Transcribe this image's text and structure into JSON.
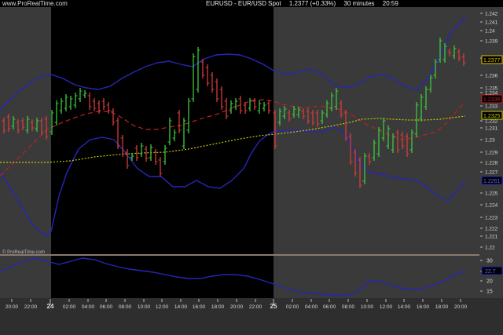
{
  "header": {
    "site": "www.ProRealTime.com",
    "symbol": "EURUSD - EUR/USD Spot",
    "price": "1.2377 (+0.33%)",
    "timeframe": "30 minutes",
    "clock": "20:59"
  },
  "watermark": "© ProRealTime.com",
  "price_axis": {
    "ticks": [
      "1.242",
      "1.241",
      "1.24",
      "1.239",
      "1.238",
      "1.236",
      "1.235",
      "1.234",
      "1.233",
      "1.232",
      "1.231",
      "1.23",
      "1.229",
      "1.228",
      "1.227",
      "1.225",
      "1.224",
      "1.223",
      "1.222",
      "1.221",
      "1.22"
    ],
    "labels": {
      "last": "1.2377",
      "ma": "1.2336",
      "slow": "1.2325",
      "lower_band": "1.2261"
    }
  },
  "indicator_axis": {
    "ticks": [
      "30",
      "25",
      "20",
      "15"
    ],
    "label": "22.7"
  },
  "time_axis": {
    "ticks": [
      "20:00",
      "22:00",
      "24",
      "02:00",
      "04:00",
      "06:00",
      "08:00",
      "10:00",
      "12:00",
      "14:00",
      "16:00",
      "18:00",
      "20:00",
      "22:00",
      "25",
      "02:00",
      "04:00",
      "06:00",
      "08:00",
      "10:00",
      "12:00",
      "14:00",
      "16:00",
      "18:00",
      "20:00"
    ]
  },
  "colors": {
    "bull": "#3cc83c",
    "bear": "#d23c3c",
    "band": "#2626b8",
    "ma": "#c02020",
    "slow": "#c8c800",
    "label_last": "#e0c000"
  }
}
